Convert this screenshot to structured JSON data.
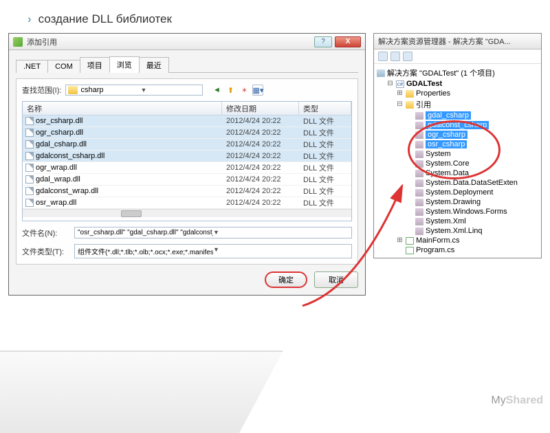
{
  "slide": {
    "title": "создание DLL библиотек"
  },
  "dialog": {
    "title": "添加引用",
    "tabs": [
      ".NET",
      "COM",
      "项目",
      "浏览",
      "最近"
    ],
    "active_tab": 3,
    "lookup_label": "查找范围(I):",
    "folder": "csharp",
    "columns": {
      "name": "名称",
      "date": "修改日期",
      "type": "类型"
    },
    "files": [
      {
        "name": "osr_csharp.dll",
        "date": "2012/4/24 20:22",
        "type": "DLL 文件",
        "sel": true
      },
      {
        "name": "ogr_csharp.dll",
        "date": "2012/4/24 20:22",
        "type": "DLL 文件",
        "sel": true
      },
      {
        "name": "gdal_csharp.dll",
        "date": "2012/4/24 20:22",
        "type": "DLL 文件",
        "sel": true
      },
      {
        "name": "gdalconst_csharp.dll",
        "date": "2012/4/24 20:22",
        "type": "DLL 文件",
        "sel": true
      },
      {
        "name": "ogr_wrap.dll",
        "date": "2012/4/24 20:22",
        "type": "DLL 文件",
        "sel": false
      },
      {
        "name": "gdal_wrap.dll",
        "date": "2012/4/24 20:22",
        "type": "DLL 文件",
        "sel": false
      },
      {
        "name": "gdalconst_wrap.dll",
        "date": "2012/4/24 20:22",
        "type": "DLL 文件",
        "sel": false
      },
      {
        "name": "osr_wrap.dll",
        "date": "2012/4/24 20:22",
        "type": "DLL 文件",
        "sel": false
      }
    ],
    "filename_label": "文件名(N):",
    "filename_value": "\"osr_csharp.dll\" \"gdal_csharp.dll\" \"gdalconst_csharp.dll\" \"ogr_cshar",
    "filetype_label": "文件类型(T):",
    "filetype_value": "组件文件(*.dll;*.tlb;*.olb;*.ocx;*.exe;*.manifest)",
    "ok": "确定",
    "cancel": "取消"
  },
  "explorer": {
    "title": "解决方案资源管理器 - 解决方案 \"GDA...",
    "solution": "解决方案 \"GDALTest\" (1 个项目)",
    "project": "GDALTest",
    "nodes": {
      "properties": "Properties",
      "references": "引用",
      "ref_items": [
        "gdal_csharp",
        "gdalconst_csharp",
        "ogr_csharp",
        "osr_csharp",
        "System",
        "System.Core",
        "System.Data",
        "System.Data.DataSetExten",
        "System.Deployment",
        "System.Drawing",
        "System.Windows.Forms",
        "System.Xml",
        "System.Xml.Linq"
      ],
      "files": [
        "MainForm.cs",
        "Program.cs"
      ]
    }
  },
  "watermark": {
    "a": "My",
    "b": "Shared"
  }
}
